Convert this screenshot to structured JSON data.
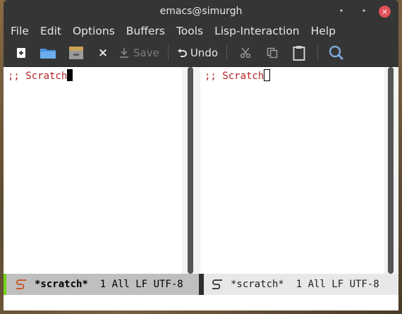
{
  "window": {
    "title": "emacs@simurgh",
    "minimize_glyph": "•",
    "maximize_glyph": "•",
    "close_glyph": "×"
  },
  "menubar": {
    "items": [
      "File",
      "Edit",
      "Options",
      "Buffers",
      "Tools",
      "Lisp-Interaction",
      "Help"
    ]
  },
  "toolbar": {
    "new_file_icon": "new-file-icon",
    "open_icon": "folder-open-icon",
    "dired_icon": "file-cabinet-icon",
    "close_glyph": "×",
    "save_label": "Save",
    "undo_label": "Undo",
    "cut_icon": "scissors-icon",
    "copy_icon": "copy-icon",
    "paste_icon": "clipboard-icon",
    "search_icon": "search-icon"
  },
  "panes": {
    "left": {
      "text": ";; Scratch"
    },
    "right": {
      "text": ";; Scratch"
    }
  },
  "modeline": {
    "left": {
      "buffer_name": "*scratch*",
      "info": "  1 All LF UTF-8"
    },
    "right": {
      "buffer_name": "*scratch*",
      "info": "  1 All LF UTF-8"
    }
  },
  "colors": {
    "comment": "#b22222",
    "active_modeline_indicator": "#73d216",
    "close_button": "#e0525a"
  }
}
